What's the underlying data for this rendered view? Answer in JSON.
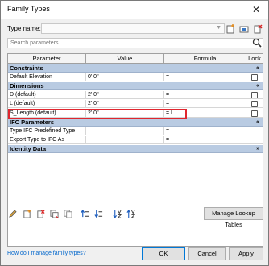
{
  "window": {
    "title": "Family Types",
    "close_glyph": "✕"
  },
  "type_row": {
    "label": "Type name:",
    "value": ""
  },
  "search": {
    "placeholder": "Search parameters"
  },
  "grid": {
    "headers": {
      "parameter": "Parameter",
      "value": "Value",
      "formula": "Formula",
      "lock": "Lock"
    },
    "groups": {
      "constraints": {
        "label": "Constraints",
        "toggle": "«"
      },
      "dimensions": {
        "label": "Dimensions",
        "toggle": "«"
      },
      "ifc": {
        "label": "IFC Parameters",
        "toggle": "«"
      },
      "identity": {
        "label": "Identity Data",
        "toggle": "»"
      }
    },
    "rows": {
      "default_elevation": {
        "parameter": "Default Elevation",
        "value": "0'  0\"",
        "formula": "="
      },
      "d": {
        "parameter": "D (default)",
        "value": "2'  0\"",
        "formula": "="
      },
      "l": {
        "parameter": "L (default)",
        "value": "2'  0\"",
        "formula": "="
      },
      "s_length": {
        "parameter": "S_Length (default)",
        "value": "2'  0\"",
        "formula": "= L"
      },
      "ifc_type": {
        "parameter": "Type IFC Predefined Type",
        "value": "",
        "formula": "="
      },
      "export_ifc": {
        "parameter": "Export Type to IFC As",
        "value": "",
        "formula": "="
      }
    }
  },
  "buttons": {
    "manage_lookup": "Manage Lookup Tables",
    "ok": "OK",
    "cancel": "Cancel",
    "apply": "Apply"
  },
  "help_link": "How do I manage family types?",
  "colors": {
    "group_header": "#b9cbe2",
    "highlight_border": "#e0262e",
    "link": "#0066cc"
  }
}
